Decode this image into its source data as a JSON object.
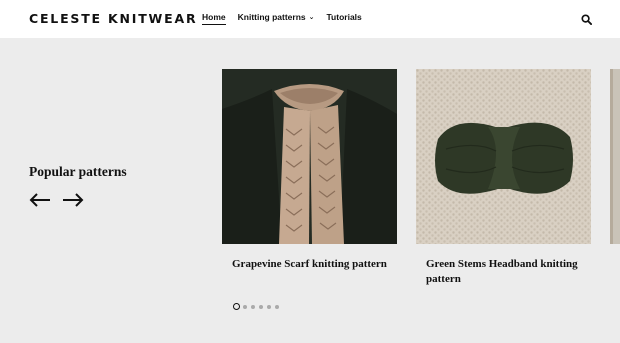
{
  "header": {
    "logo": "CELESTE KNITWEAR",
    "nav": [
      {
        "label": "Home",
        "active": true
      },
      {
        "label": "Knitting patterns",
        "has_dropdown": true
      },
      {
        "label": "Tutorials"
      }
    ],
    "search_icon": "search-icon"
  },
  "main": {
    "section_title": "Popular patterns",
    "prev_icon": "arrow-left-icon",
    "next_icon": "arrow-right-icon",
    "cards": [
      {
        "title": "Grapevine Scarf knitting pattern",
        "image": "beige lace scarf on dark sweater"
      },
      {
        "title": "Green Stems Headband knitting pattern",
        "image": "dark green twisted headband on oatmeal knit"
      }
    ],
    "pagination": {
      "total": 6,
      "current": 1
    }
  },
  "colors": {
    "background": "#ececec",
    "header_bg": "#ffffff",
    "text": "#111111",
    "dot_inactive": "#aaaaaa"
  }
}
